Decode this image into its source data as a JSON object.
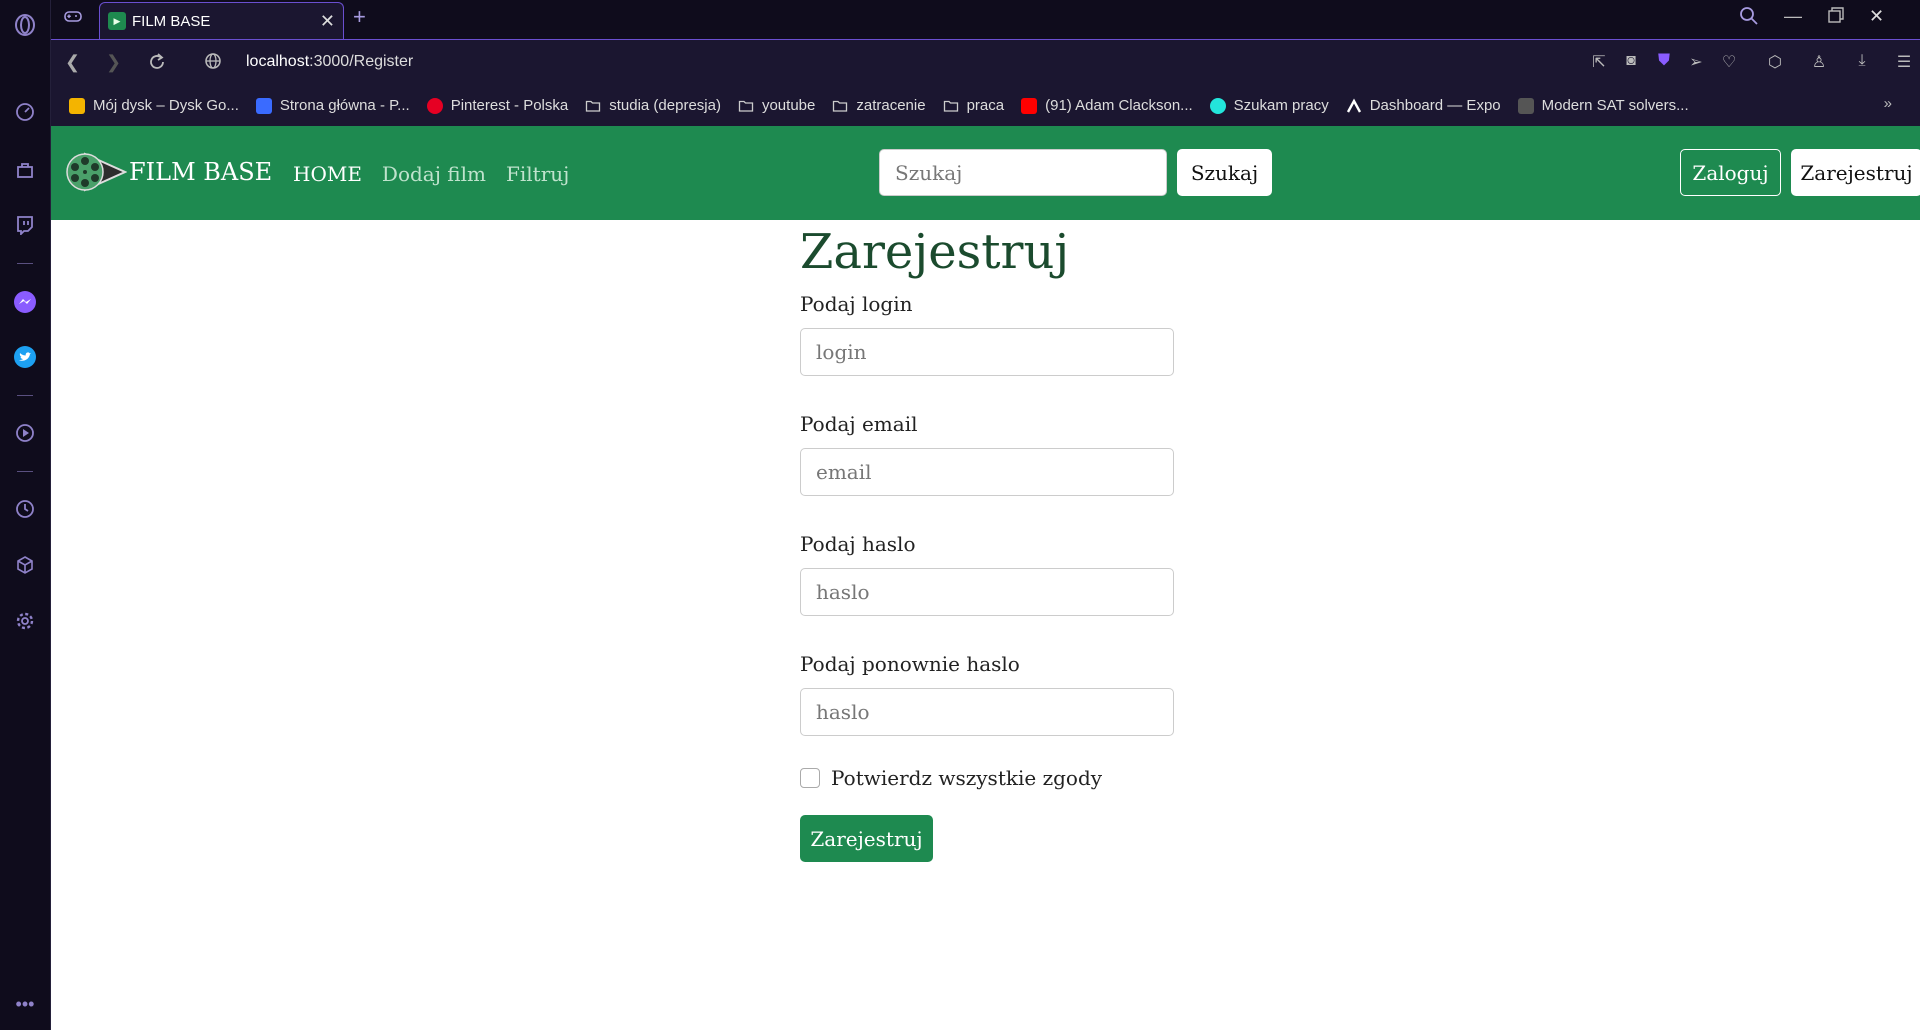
{
  "browser": {
    "tab_title": "FILM BASE",
    "tab_favicon": "film",
    "url_host": "localhost",
    "url_rest": ":3000/Register",
    "accent": "#6a4fd0"
  },
  "bookmarks": [
    {
      "label": "Mój dysk – Dysk Go...",
      "icon": "google-drive-icon",
      "color": "#f4b400"
    },
    {
      "label": "Strona główna - P...",
      "icon": "t-logo-icon",
      "color": "#3a6bff"
    },
    {
      "label": "Pinterest - Polska",
      "icon": "pinterest-icon",
      "color": "#e60023"
    },
    {
      "label": "studia (depresja)",
      "icon": "folder-icon",
      "color": "transparent"
    },
    {
      "label": "youtube",
      "icon": "folder-icon",
      "color": "transparent"
    },
    {
      "label": "zatracenie",
      "icon": "folder-icon",
      "color": "transparent"
    },
    {
      "label": "praca",
      "icon": "folder-icon",
      "color": "transparent"
    },
    {
      "label": "(91) Adam Clackson...",
      "icon": "youtube-icon",
      "color": "#ff0000"
    },
    {
      "label": "Szukam pracy",
      "icon": "olx-icon",
      "color": "#23e5db"
    },
    {
      "label": "Dashboard — Expo",
      "icon": "expo-icon",
      "color": "transparent"
    },
    {
      "label": "Modern SAT solvers...",
      "icon": "doc-icon",
      "color": "#555"
    }
  ],
  "navbar": {
    "brand": "FILM BASE",
    "links": [
      "HOME",
      "Dodaj film",
      "Filtruj"
    ],
    "search_placeholder": "Szukaj",
    "search_button": "Szukaj",
    "login_button": "Zaloguj",
    "register_button": "Zarejestruj",
    "color": "#1e8a50"
  },
  "form": {
    "title": "Zarejestruj",
    "login_label": "Podaj login",
    "login_placeholder": "login",
    "email_label": "Podaj email",
    "email_placeholder": "email",
    "password_label": "Podaj haslo",
    "password_placeholder": "haslo",
    "password2_label": "Podaj ponownie haslo",
    "password2_placeholder": "haslo",
    "consent_label": "Potwierdz wszystkie zgody",
    "consent_checked": false,
    "submit_label": "Zarejestruj"
  }
}
